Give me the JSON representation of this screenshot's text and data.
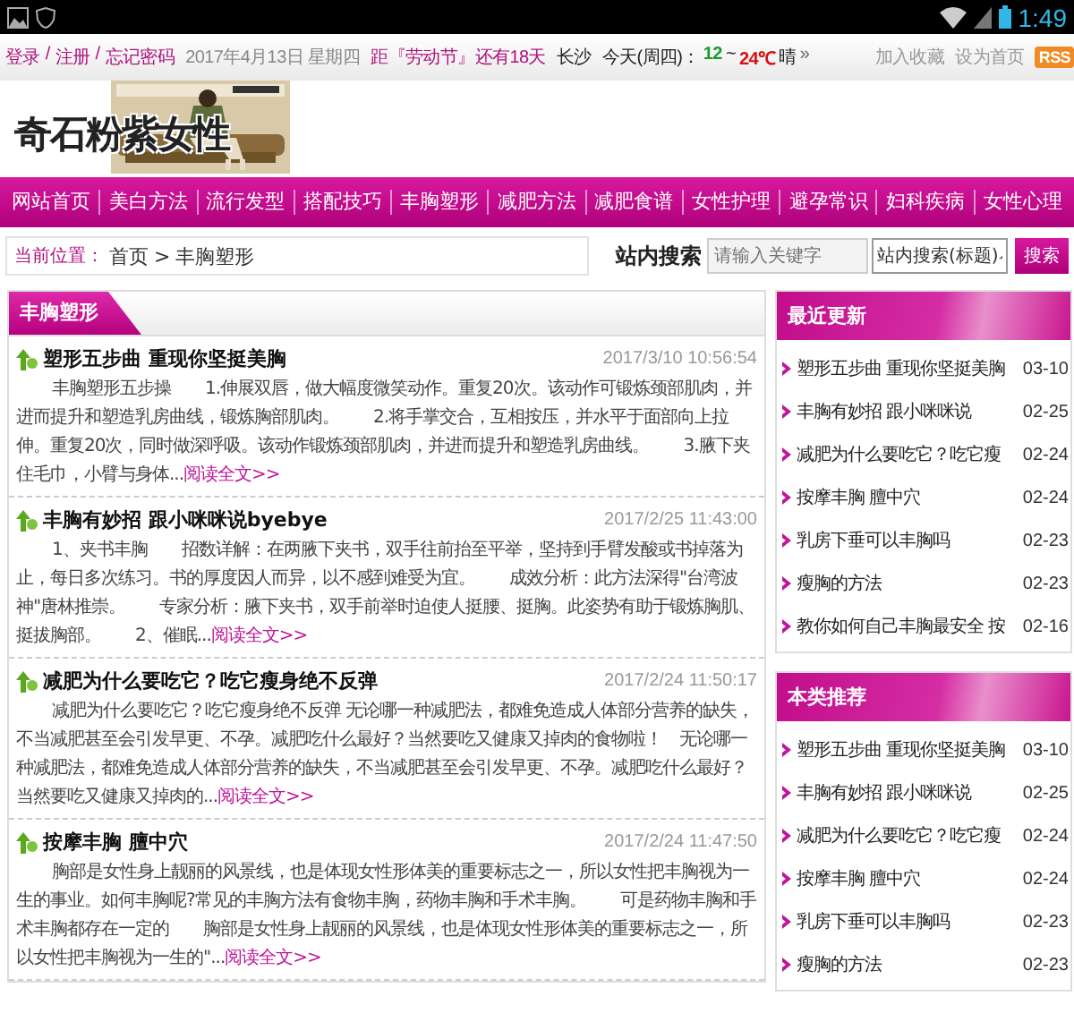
{
  "status_bar": {
    "time": "1:49"
  },
  "top_bar": {
    "account_links": [
      "登录",
      "注册",
      "忘记密码"
    ],
    "separator": "/",
    "date": "2017年4月13日 星期四",
    "countdown": "距『劳动节』还有18天",
    "weather": {
      "city": "长沙",
      "day": "今天(周四)：",
      "low": "12",
      "range_sep": "~",
      "high": "24℃",
      "condition": "晴",
      "more": "»"
    },
    "links": [
      "加入收藏",
      "设为首页"
    ],
    "rss_badge": "RSS"
  },
  "logo": {
    "text": "奇石粉紫女性"
  },
  "nav": [
    "网站首页",
    "美白方法",
    "流行发型",
    "搭配技巧",
    "丰胸塑形",
    "减肥方法",
    "减肥食谱",
    "女性护理",
    "避孕常识",
    "妇科疾病",
    "女性心理"
  ],
  "breadcrumb": {
    "label": "当前位置：",
    "items": [
      "首页",
      "丰胸塑形"
    ],
    "separator": ">"
  },
  "search": {
    "label": "站内搜索",
    "placeholder": "请输入关键字",
    "scope": "站内搜索(标题)",
    "button": "搜索"
  },
  "main": {
    "title": "丰胸塑形",
    "articles": [
      {
        "title": "塑形五步曲 重现你坚挺美胸",
        "date": "2017/3/10 10:56:54",
        "summary": "丰胸塑形五步操　　1.伸展双唇，做大幅度微笑动作。重复20次。该动作可锻炼颈部肌肉，并进而提升和塑造乳房曲线，锻炼胸部肌肉。　　2.将手掌交合，互相按压，并水平于面部向上拉伸。重复20次，同时做深呼吸。该动作锻炼颈部肌肉，并进而提升和塑造乳房曲线。　　3.腋下夹住毛巾，小臂与身体...",
        "read_more": "阅读全文>>"
      },
      {
        "title": "丰胸有妙招 跟小咪咪说byebye",
        "date": "2017/2/25 11:43:00",
        "summary": "1、夹书丰胸　　招数详解：在两腋下夹书，双手往前抬至平举，坚持到手臂发酸或书掉落为止，每日多次练习。书的厚度因人而异，以不感到难受为宜。　　成效分析：此方法深得\"台湾波神\"唐林推崇。　　专家分析：腋下夹书，双手前举时迫使人挺腰、挺胸。此姿势有助于锻炼胸肌、挺拔胸部。　　2、催眠...",
        "read_more": "阅读全文>>"
      },
      {
        "title": "减肥为什么要吃它？吃它瘦身绝不反弹",
        "date": "2017/2/24 11:50:17",
        "summary": "减肥为什么要吃它？吃它瘦身绝不反弹 无论哪一种减肥法，都难免造成人体部分营养的缺失，不当减肥甚至会引发早更、不孕。减肥吃什么最好？当然要吃又健康又掉肉的食物啦！　无论哪一种减肥法，都难免造成人体部分营养的缺失，不当减肥甚至会引发早更、不孕。减肥吃什么最好？当然要吃又健康又掉肉的...",
        "read_more": "阅读全文>>"
      },
      {
        "title": "按摩丰胸 膻中穴",
        "date": "2017/2/24 11:47:50",
        "summary": "胸部是女性身上靓丽的风景线，也是体现女性形体美的重要标志之一，所以女性把丰胸视为一生的事业。如何丰胸呢?常见的丰胸方法有食物丰胸，药物丰胸和手术丰胸。　　可是药物丰胸和手术丰胸都存在一定的　　胸部是女性身上靓丽的风景线，也是体现女性形体美的重要标志之一，所以女性把丰胸视为一生的\"...",
        "read_more": "阅读全文>>"
      }
    ]
  },
  "sidebar": [
    {
      "title": "最近更新",
      "items": [
        {
          "title": "塑形五步曲 重现你坚挺美胸",
          "date": "03-10"
        },
        {
          "title": "丰胸有妙招 跟小咪咪说",
          "date": "02-25"
        },
        {
          "title": "减肥为什么要吃它？吃它瘦",
          "date": "02-24"
        },
        {
          "title": "按摩丰胸 膻中穴",
          "date": "02-24"
        },
        {
          "title": "乳房下垂可以丰胸吗",
          "date": "02-23"
        },
        {
          "title": "瘦胸的方法",
          "date": "02-23"
        },
        {
          "title": "教你如何自己丰胸最安全 按",
          "date": "02-16"
        }
      ]
    },
    {
      "title": "本类推荐",
      "items": [
        {
          "title": "塑形五步曲 重现你坚挺美胸",
          "date": "03-10"
        },
        {
          "title": "丰胸有妙招 跟小咪咪说",
          "date": "02-25"
        },
        {
          "title": "减肥为什么要吃它？吃它瘦",
          "date": "02-24"
        },
        {
          "title": "按摩丰胸 膻中穴",
          "date": "02-24"
        },
        {
          "title": "乳房下垂可以丰胸吗",
          "date": "02-23"
        },
        {
          "title": "瘦胸的方法",
          "date": "02-23"
        }
      ]
    }
  ]
}
